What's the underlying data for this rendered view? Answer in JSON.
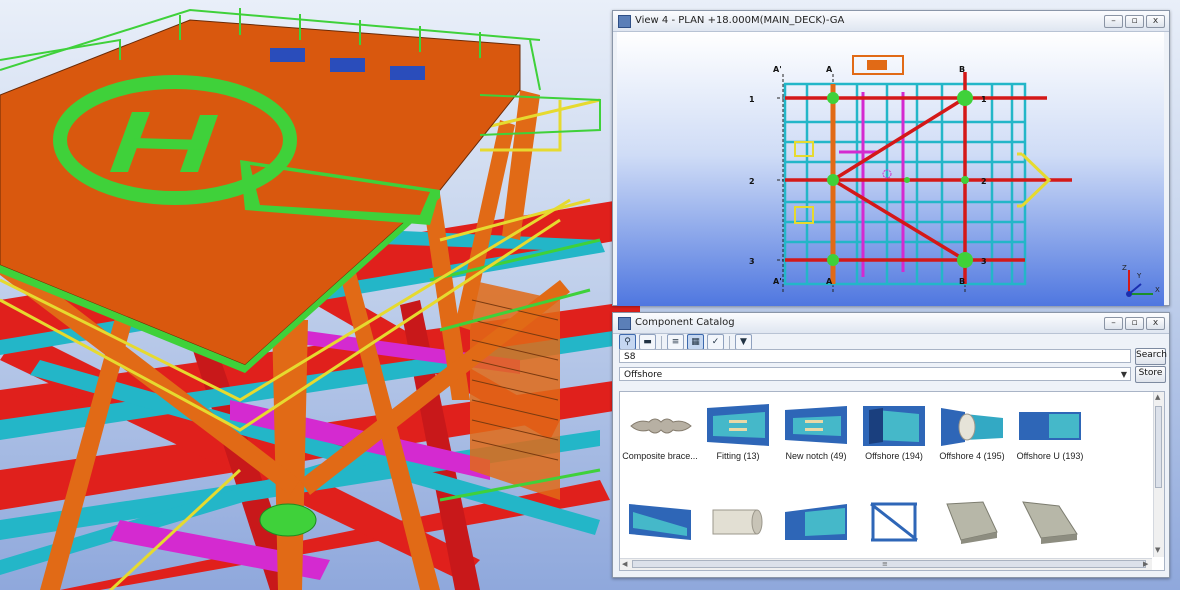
{
  "view4": {
    "title": "View 4 - PLAN +18.000M(MAIN_DECK)-GA",
    "grid_labels": [
      "A'",
      "A",
      "B",
      "1",
      "1",
      "2",
      "2",
      "3",
      "3",
      "A'",
      "A",
      "B"
    ],
    "axis_labels": [
      "Z",
      "Y",
      "X"
    ]
  },
  "window_buttons": {
    "minimize": "–",
    "restore": "▫",
    "close": "x"
  },
  "catalog": {
    "title": "Component Catalog",
    "toolbar_glyphs": [
      "⚲",
      "▬",
      "≡",
      "▦",
      "✓",
      "▼"
    ],
    "search": {
      "value": "S8",
      "button": "Search"
    },
    "category": {
      "value": "Offshore",
      "button": "Store"
    },
    "items": [
      {
        "label": "Composite brace...",
        "icon": "brace-icon"
      },
      {
        "label": "Fitting (13)",
        "icon": "fitting-icon"
      },
      {
        "label": "New notch (49)",
        "icon": "notch-icon"
      },
      {
        "label": "Offshore (194)",
        "icon": "offshore-icon"
      },
      {
        "label": "Offshore 4 (195)",
        "icon": "tube-joint-icon"
      },
      {
        "label": "Offshore U (193)",
        "icon": "u-section-icon"
      },
      {
        "label": "",
        "icon": "beam-cut-icon"
      },
      {
        "label": "",
        "icon": "pipe-icon"
      },
      {
        "label": "",
        "icon": "beam-end-icon"
      },
      {
        "label": "",
        "icon": "truss-panel-icon"
      },
      {
        "label": "",
        "icon": "i-beam-icon"
      },
      {
        "label": "",
        "icon": "i-beam-angled-icon"
      }
    ],
    "scroll_glyphs": {
      "up": "▲",
      "down": "▼",
      "left": "◀",
      "right": "▶",
      "grip": "≡"
    }
  },
  "colors": {
    "deck": "#d9580e",
    "helipad": "#3fd13a",
    "steel_red": "#e0201c",
    "steel_cyan": "#23b6c8",
    "steel_orange": "#e16a16",
    "rail_yellow": "#e6da2f",
    "magenta": "#d42ad0"
  }
}
